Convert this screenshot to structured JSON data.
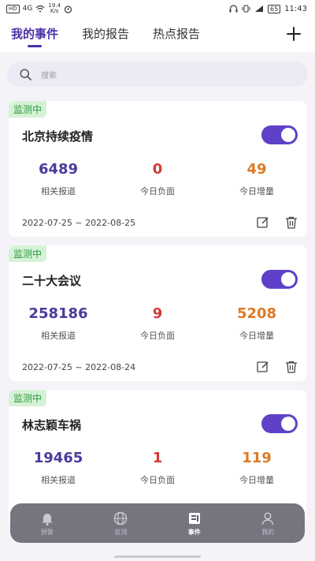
{
  "status_bar": {
    "carrier_badge": "HD",
    "signal": "4G",
    "speed_value": "19.4",
    "speed_unit": "K/s",
    "battery": "65",
    "time": "11:43"
  },
  "tabs": [
    {
      "label": "我的事件",
      "active": true
    },
    {
      "label": "我的报告",
      "active": false
    },
    {
      "label": "热点报告",
      "active": false
    }
  ],
  "search": {
    "placeholder": "搜索"
  },
  "events": [
    {
      "badge": "监测中",
      "title": "北京持续疫情",
      "enabled": true,
      "stats": [
        {
          "value": "6489",
          "label": "相关报道"
        },
        {
          "value": "0",
          "label": "今日负面"
        },
        {
          "value": "49",
          "label": "今日增量"
        }
      ],
      "date_range": "2022-07-25 ~ 2022-08-25"
    },
    {
      "badge": "监测中",
      "title": "二十大会议",
      "enabled": true,
      "stats": [
        {
          "value": "258186",
          "label": "相关报道"
        },
        {
          "value": "9",
          "label": "今日负面"
        },
        {
          "value": "5208",
          "label": "今日增量"
        }
      ],
      "date_range": "2022-07-25 ~ 2022-08-24"
    },
    {
      "badge": "监测中",
      "title": "林志颖车祸",
      "enabled": true,
      "stats": [
        {
          "value": "19465",
          "label": "相关报道"
        },
        {
          "value": "1",
          "label": "今日负面"
        },
        {
          "value": "119",
          "label": "今日增量"
        }
      ],
      "date_range": ""
    }
  ],
  "bottom_nav": [
    {
      "label": "预警",
      "icon": "bell-icon",
      "active": false
    },
    {
      "label": "监测",
      "icon": "globe-icon",
      "active": false
    },
    {
      "label": "事件",
      "icon": "events-icon",
      "active": true
    },
    {
      "label": "我的",
      "icon": "user-icon",
      "active": false
    }
  ],
  "colors": {
    "accent": "#4b2fa8",
    "toggle": "#5f41c8",
    "badge_bg": "#d6f2d6",
    "badge_text": "#2f9a3c",
    "reports": "#4b3a9c",
    "negative": "#d23a3a",
    "increase": "#dd7a24"
  }
}
